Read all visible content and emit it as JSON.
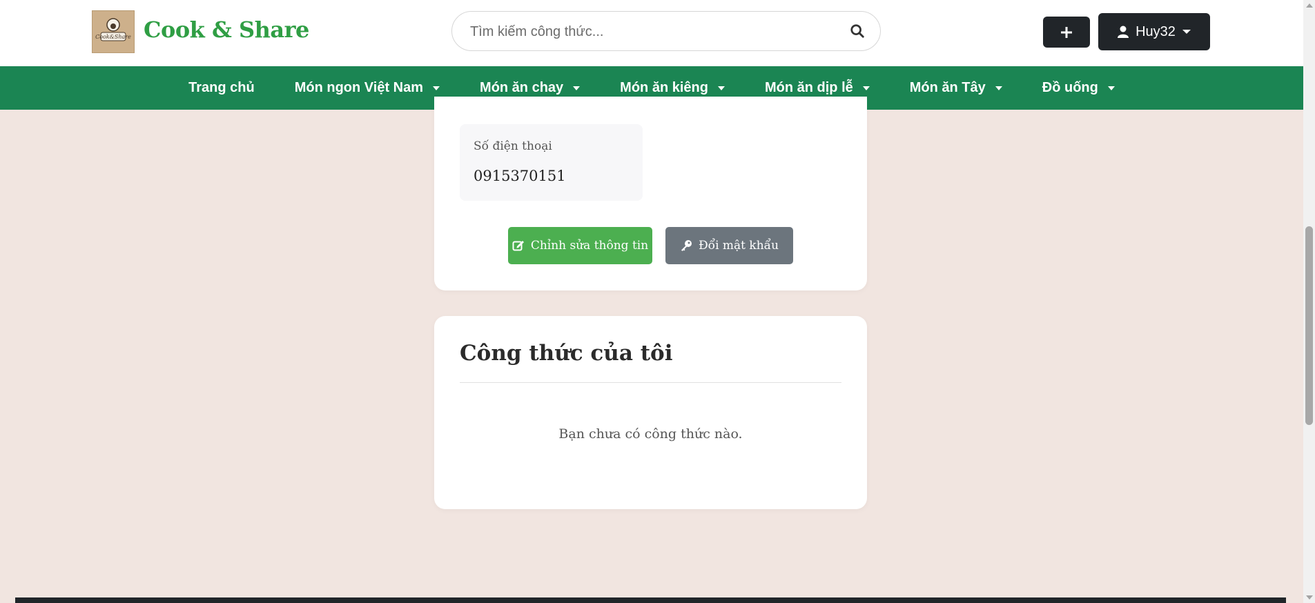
{
  "header": {
    "brand": "Cook & Share",
    "logo_text": "Cook&Share",
    "search": {
      "placeholder": "Tìm kiếm công thức..."
    },
    "add_label": "+",
    "user": {
      "name": "Huy32"
    }
  },
  "nav": {
    "items": [
      {
        "label": "Trang chủ",
        "dropdown": false
      },
      {
        "label": "Món ngon Việt Nam",
        "dropdown": true
      },
      {
        "label": "Món ăn chay",
        "dropdown": true
      },
      {
        "label": "Món ăn kiêng",
        "dropdown": true
      },
      {
        "label": "Món ăn dịp lễ",
        "dropdown": true
      },
      {
        "label": "Món ăn Tây",
        "dropdown": true
      },
      {
        "label": "Đồ uống",
        "dropdown": true
      }
    ]
  },
  "profile": {
    "phone_label": "Số điện thoại",
    "phone_value": "0915370151",
    "edit_button": "Chỉnh sửa thông tin",
    "password_button": "Đổi mật khẩu"
  },
  "recipes": {
    "title": "Công thức của tôi",
    "empty_message": "Bạn chưa có công thức nào."
  },
  "colors": {
    "brand": "#2f9e44",
    "nav_bg": "#1b8553",
    "page_bg": "#f1e5e0",
    "edit_button": "#4caf50",
    "password_button": "#6c757d",
    "dark_button": "#212529"
  }
}
